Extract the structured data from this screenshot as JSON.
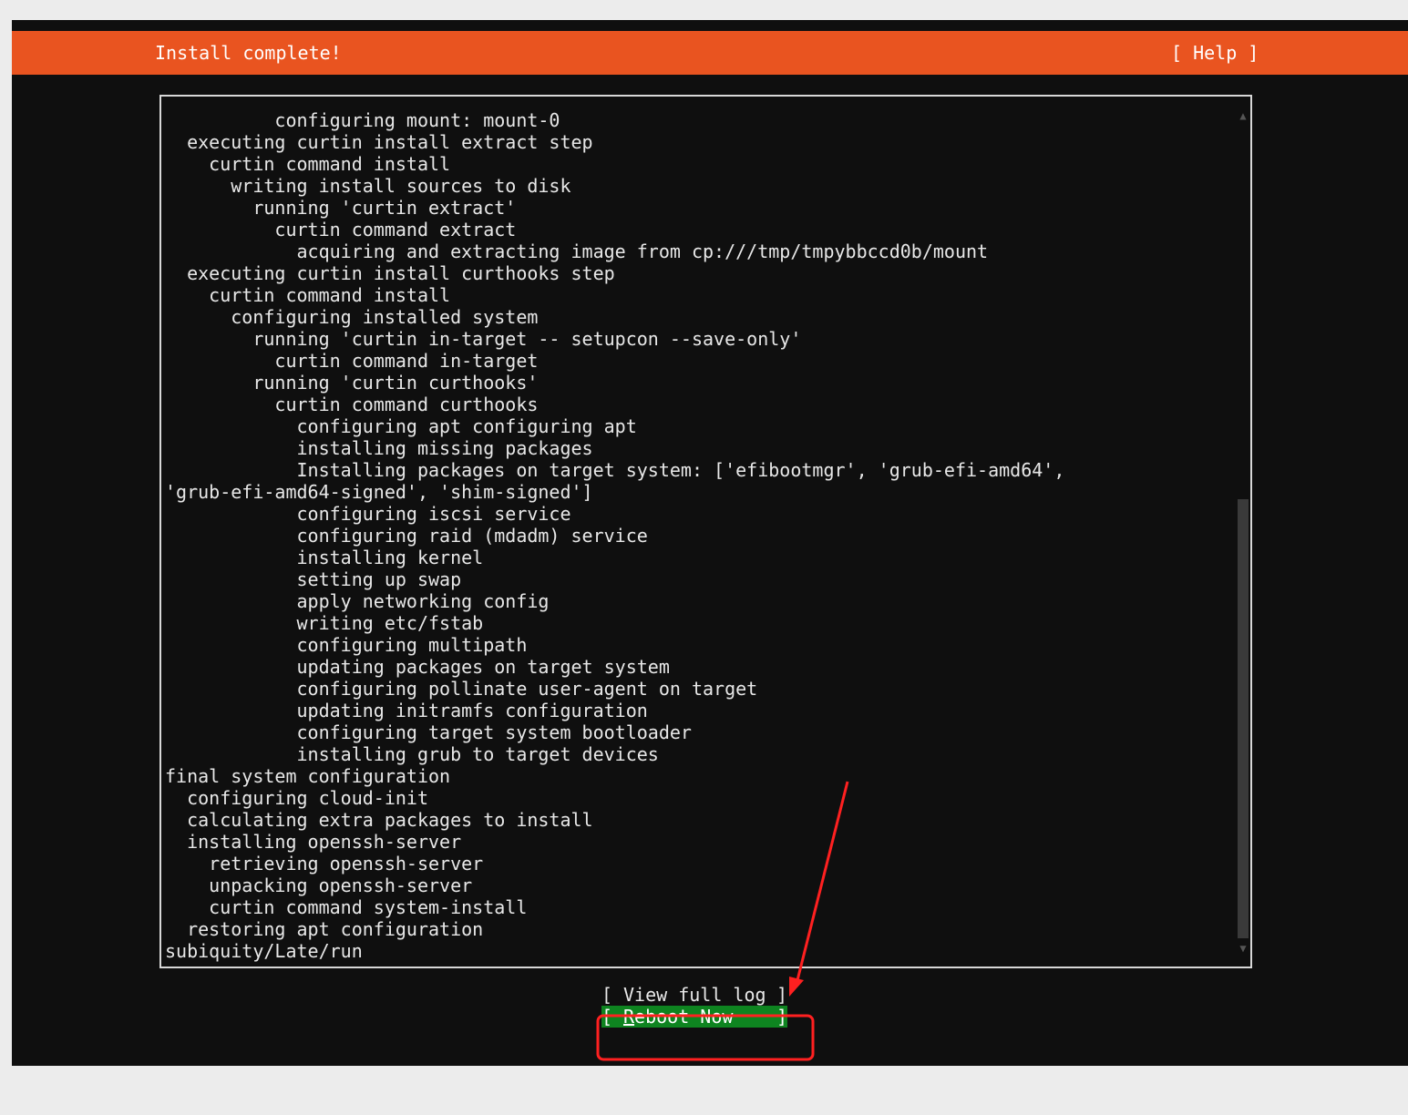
{
  "header": {
    "title": "Install complete!",
    "help_label": "[ Help ]"
  },
  "log": {
    "lines": [
      "          configuring mount: mount-0",
      "  executing curtin install extract step",
      "    curtin command install",
      "      writing install sources to disk",
      "        running 'curtin extract'",
      "          curtin command extract",
      "            acquiring and extracting image from cp:///tmp/tmpybbccd0b/mount",
      "  executing curtin install curthooks step",
      "    curtin command install",
      "      configuring installed system",
      "        running 'curtin in-target -- setupcon --save-only'",
      "          curtin command in-target",
      "        running 'curtin curthooks'",
      "          curtin command curthooks",
      "            configuring apt configuring apt",
      "            installing missing packages",
      "            Installing packages on target system: ['efibootmgr', 'grub-efi-amd64',",
      "'grub-efi-amd64-signed', 'shim-signed']",
      "            configuring iscsi service",
      "            configuring raid (mdadm) service",
      "            installing kernel",
      "            setting up swap",
      "            apply networking config",
      "            writing etc/fstab",
      "            configuring multipath",
      "            updating packages on target system",
      "            configuring pollinate user-agent on target",
      "            updating initramfs configuration",
      "            configuring target system bootloader",
      "            installing grub to target devices",
      "final system configuration",
      "  configuring cloud-init",
      "  calculating extra packages to install",
      "  installing openssh-server",
      "    retrieving openssh-server",
      "    unpacking openssh-server",
      "    curtin command system-install",
      "  restoring apt configuration",
      "subiquity/Late/run"
    ]
  },
  "buttons": {
    "view_log_label": "View full log",
    "reboot_first": "R",
    "reboot_rest": "eboot Now",
    "bracket_open": "[",
    "bracket_close": "]"
  },
  "colors": {
    "header_bg": "#e95420",
    "selected_button_bg": "#0e8420",
    "annotation": "#ff2020"
  }
}
